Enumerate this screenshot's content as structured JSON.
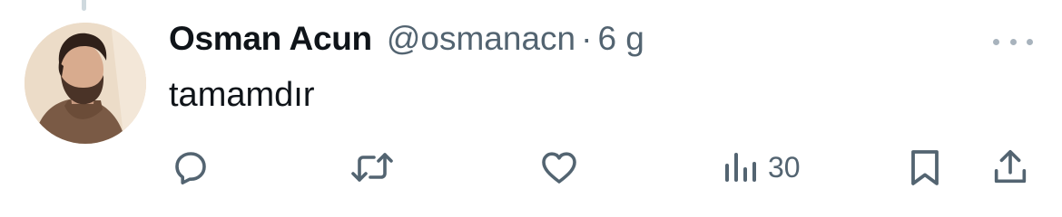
{
  "tweet": {
    "author_name": "Osman Acun",
    "handle": "@osmanacn",
    "separator": "·",
    "time": "6 g",
    "text": "tamamdır"
  },
  "actions": {
    "reply": {
      "icon": "reply-icon"
    },
    "retweet": {
      "icon": "retweet-icon"
    },
    "like": {
      "icon": "heart-icon"
    },
    "views": {
      "icon": "views-icon",
      "count": "30"
    },
    "bookmark": {
      "icon": "bookmark-icon"
    },
    "share": {
      "icon": "share-icon"
    }
  },
  "colors": {
    "text": "#0f1419",
    "muted": "#536471",
    "thread_line": "#cfd9de"
  }
}
